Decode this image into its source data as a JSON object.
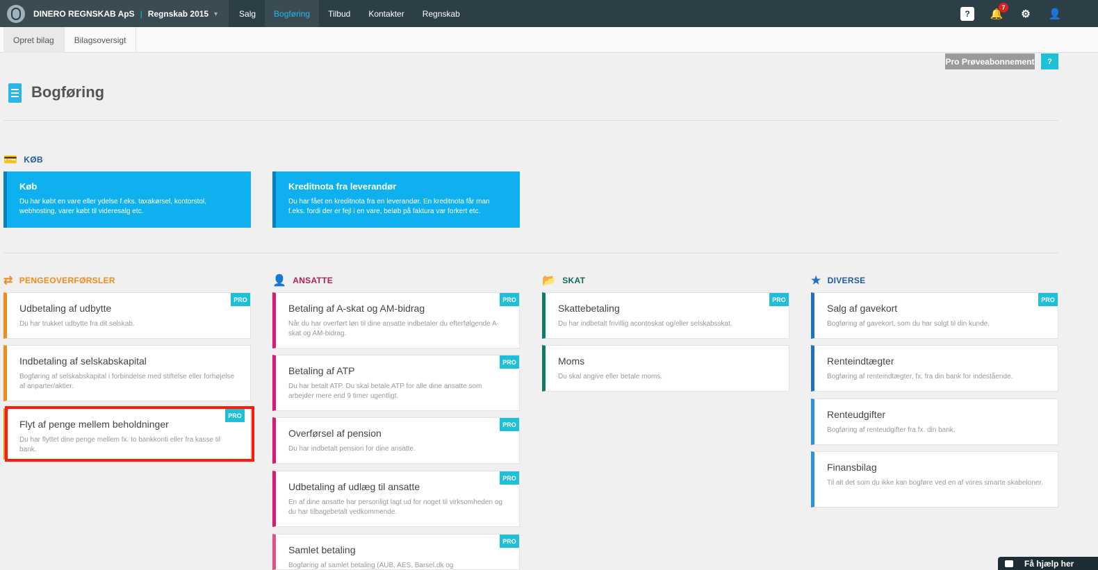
{
  "topbar": {
    "company": "DINERO REGNSKAB ApS",
    "separator": "|",
    "year": "Regnskab 2015",
    "nav": [
      "Salg",
      "Bogføring",
      "Tilbud",
      "Kontakter",
      "Regnskab"
    ],
    "notifications_count": "7",
    "help_glyph": "?"
  },
  "subnav": [
    "Opret bilag",
    "Bilagsoversigt"
  ],
  "pro_trial_label": "Pro Prøveabonnement",
  "help_glyph": "?",
  "page_title": "Bogføring",
  "colors": {
    "accent": "#22b8e6",
    "kob_blue": "#0eb0f0",
    "penge_orange": "#f08c1e",
    "ansatte_pink": "#d81b70",
    "skat_teal": "#0f7a6a",
    "diverse_blue": "#1e6fc8",
    "pro_badge": "#1ec0d8",
    "highlight_red": "#ff1a0a"
  },
  "sections": {
    "kob": {
      "title": "KØB",
      "icon": "credit-card-icon",
      "cards": [
        {
          "title": "Køb",
          "desc": "Du har købt en vare eller ydelse f.eks. taxakørsel, kontorstol, webhosting, varer købt til videresalg etc."
        },
        {
          "title": "Kreditnota fra leverandør",
          "desc": "Du har fået en kreditnota fra en leverandør. En kreditnota får man f.eks. fordi der er fejl i en vare, beløb på faktura var forkert etc."
        }
      ]
    },
    "penge": {
      "title": "PENGEOVERFØRSLER",
      "icon": "exchange-arrows-icon",
      "cards": [
        {
          "title": "Udbetaling af udbytte",
          "desc": "Du har trukket udbytte fra dit selskab.",
          "pro": "PRO"
        },
        {
          "title": "Indbetaling af selskabskapital",
          "desc": "Bogføring af selskabskapital i forbindelse med stiftelse eller forhøjelse af anparter/aktier."
        },
        {
          "title": "Flyt af penge mellem beholdninger",
          "desc": "Du har flyttet dine penge mellem fx. to bankkonti eller fra kasse til bank.",
          "pro": "PRO"
        }
      ]
    },
    "ansatte": {
      "title": "ANSATTE",
      "icon": "user-icon",
      "cards": [
        {
          "title": "Betaling af A-skat og AM-bidrag",
          "desc": "Når du har overført løn til dine ansatte indbetaler du efterfølgende A-skat og AM-bidrag.",
          "pro": "PRO"
        },
        {
          "title": "Betaling af ATP",
          "desc": "Du har betalt ATP. Du skal betale ATP for alle dine ansatte som arbejder mere end 9 timer ugentligt.",
          "pro": "PRO"
        },
        {
          "title": "Overførsel af pension",
          "desc": "Du har indbetalt pension for dine ansatte.",
          "pro": "PRO"
        },
        {
          "title": "Udbetaling af udlæg til ansatte",
          "desc": "En af dine ansatte har personligt lagt ud for noget til virksomheden og du har tilbagebetalt vedkommende.",
          "pro": "PRO"
        },
        {
          "title": "Samlet betaling",
          "desc": "Bogføring af samlet betaling (AUB, AES, Barsel.dk og",
          "pro": "PRO"
        }
      ]
    },
    "skat": {
      "title": "SKAT",
      "icon": "folder-open-icon",
      "cards": [
        {
          "title": "Skattebetaling",
          "desc": "Du har indbetalt frivillig acontoskat og/eller selskabsskat.",
          "pro": "PRO"
        },
        {
          "title": "Moms",
          "desc": "Du skal angive eller betale moms."
        }
      ]
    },
    "diverse": {
      "title": "DIVERSE",
      "icon": "star-icon",
      "cards": [
        {
          "title": "Salg af gavekort",
          "desc": "Bogføring af gavekort, som du har solgt til din kunde.",
          "pro": "PRO"
        },
        {
          "title": "Renteindtægter",
          "desc": "Bogføring af renteindtægter, fx. fra din bank for indestående."
        },
        {
          "title": "Renteudgifter",
          "desc": "Bogføring af renteudgifter fra fx. din bank."
        },
        {
          "title": "Finansbilag",
          "desc": "Til alt det som du ikke kan bogføre ved en af vores smarte skabeloner."
        }
      ]
    }
  },
  "help_chat_label": "Få hjælp her"
}
